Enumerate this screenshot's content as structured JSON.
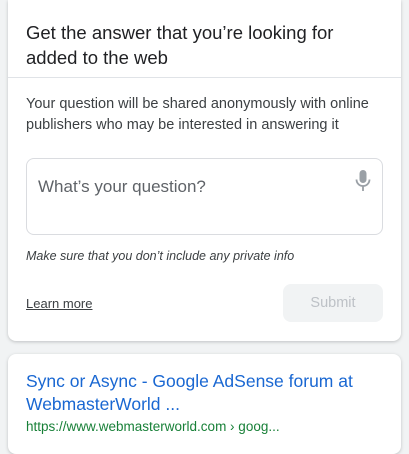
{
  "question_card": {
    "header": "Get the answer that you’re looking for added to the web",
    "description": "Your question will be shared anonymously with online publishers who may be interested in answering it",
    "input": {
      "placeholder": "What’s your question?",
      "value": ""
    },
    "mic_icon": "microphone-icon",
    "hint": "Make sure that you don’t include any private info",
    "learn_more": "Learn more",
    "submit": "Submit"
  },
  "result": {
    "title": "Sync or Async - Google AdSense forum at WebmasterWorld ...",
    "url": "https://www.webmasterworld.com › goog..."
  },
  "colors": {
    "link_blue": "#1967d2",
    "url_green": "#188038",
    "disabled_text": "#bdc1c6"
  }
}
